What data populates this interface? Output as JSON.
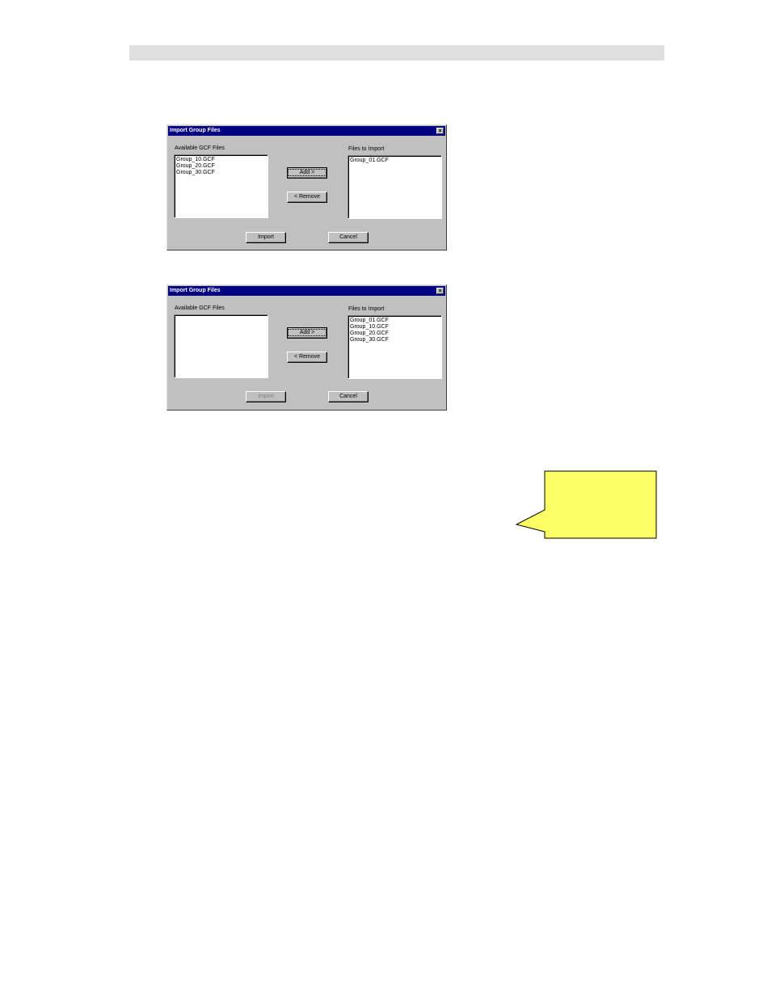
{
  "dialogs": [
    {
      "title": "Import Group Files",
      "available_label": "Available GCF Files",
      "available_files": [
        "Group_10.GCF",
        "Group_20.GCF",
        "Group_30.GCF"
      ],
      "import_label": "Files to Import",
      "import_files": [
        "Group_01.GCF"
      ],
      "add_label": "Add >",
      "remove_label": "< Remove",
      "import_button": "Import",
      "cancel_button": "Cancel"
    },
    {
      "title": "Import Group Files",
      "available_label": "Available GCF Files",
      "available_files": [],
      "import_label": "Files to Import",
      "import_files": [
        "Group_01.GCF",
        "Group_10.GCF",
        "Group_20.GCF",
        "Group_30.GCF"
      ],
      "add_label": "Add >",
      "remove_label": "< Remove",
      "import_button": "Import",
      "cancel_button": "Cancel"
    }
  ],
  "colors": {
    "titlebar": "#000080",
    "dialog_face": "#c0c0c0",
    "callout_fill": "#ffff66"
  }
}
